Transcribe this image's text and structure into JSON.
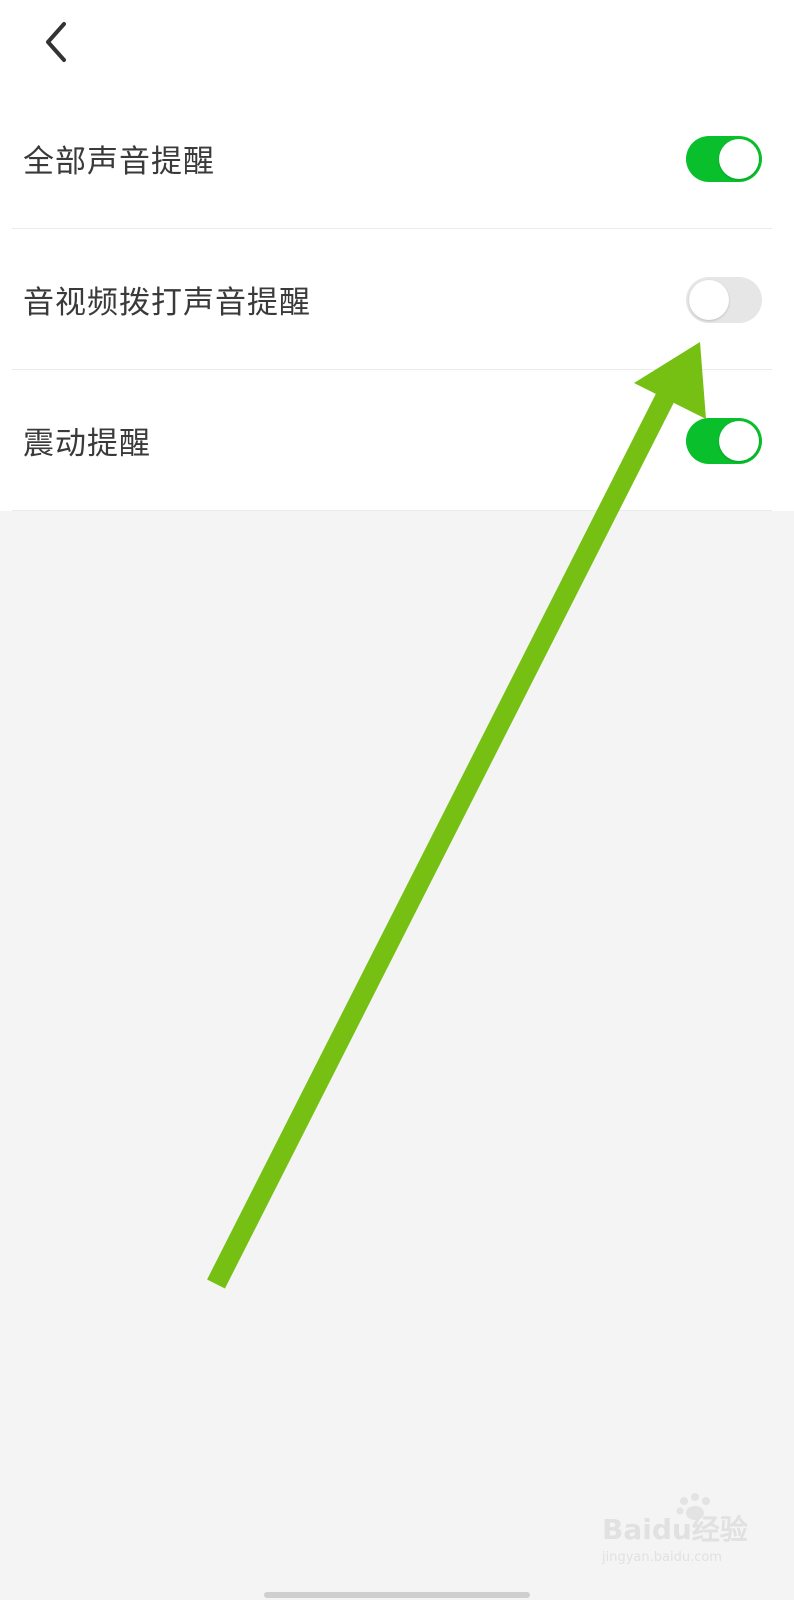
{
  "header": {
    "back_icon": "chevron-left-icon"
  },
  "settings": [
    {
      "label": "全部声音提醒",
      "enabled": true
    },
    {
      "label": "音视频拨打声音提醒",
      "enabled": false
    },
    {
      "label": "震动提醒",
      "enabled": true
    }
  ],
  "colors": {
    "toggle_on": "#09c02c",
    "toggle_off": "#e6e6e6",
    "annotation_arrow": "#76c014",
    "page_background": "#f4f4f4"
  },
  "watermark": {
    "brand": "Baidu经验",
    "url": "jingyan.baidu.com"
  }
}
